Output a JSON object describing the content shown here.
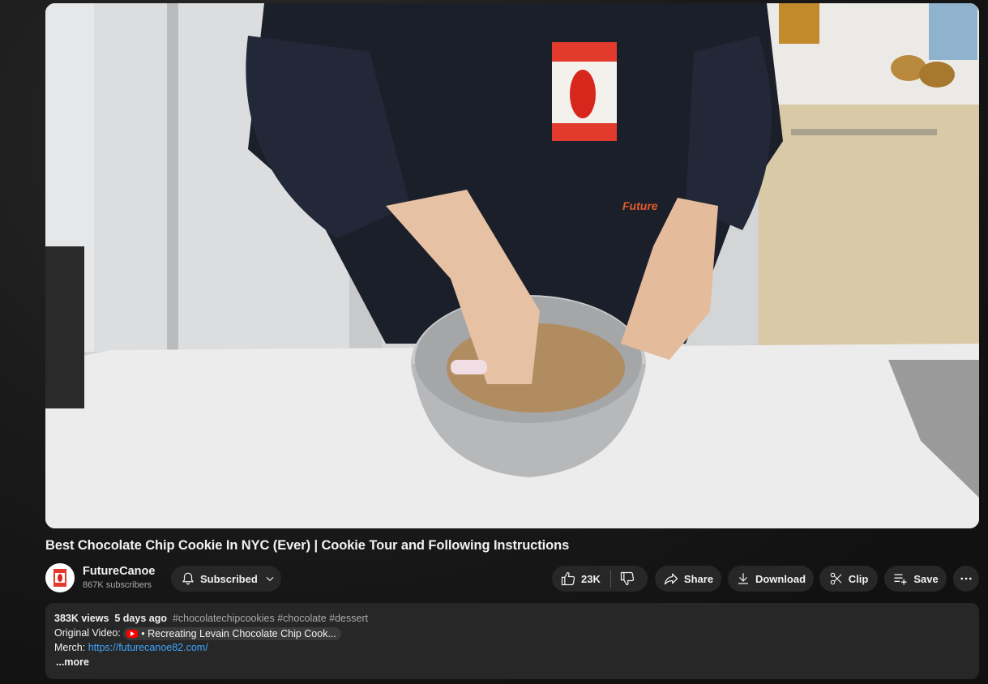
{
  "video": {
    "title": "Best Chocolate Chip Cookie In NYC (Ever) | Cookie Tour and Following Instructions"
  },
  "channel": {
    "name": "FutureCanoe",
    "subscribers": "867K subscribers",
    "subscribe_label": "Subscribed"
  },
  "actions": {
    "like_count": "23K",
    "share_label": "Share",
    "download_label": "Download",
    "clip_label": "Clip",
    "save_label": "Save"
  },
  "description": {
    "views": "383K views",
    "date": "5 days ago",
    "hashtags": "#chocolatechipcookies #chocolate #dessert",
    "original_label": "Original Video:",
    "original_link": "• Recreating Levain Chocolate Chip Cook...",
    "merch_label": "Merch:",
    "merch_url": "https://futurecanoe82.com/",
    "more_label": "...more"
  },
  "colors": {
    "background": "#0f0f0f",
    "pill": "#272727",
    "link": "#3ea6ff",
    "youtube_red": "#ff0000"
  }
}
